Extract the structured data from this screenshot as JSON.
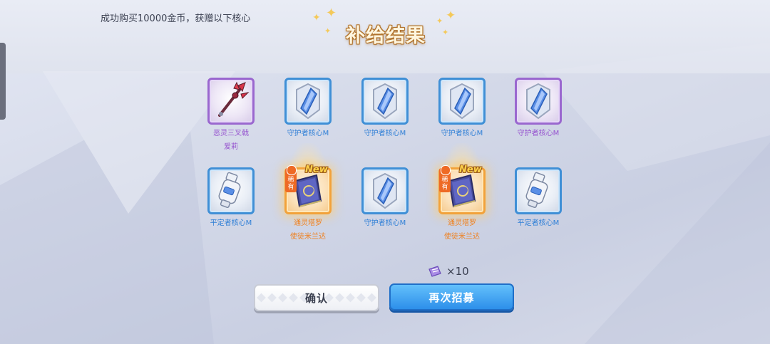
{
  "notice": "成功购买10000金币，获赠以下核心",
  "title": "补给结果",
  "items": [
    {
      "name": "恶灵三叉戟",
      "sub": "爱莉",
      "rarity": "purple",
      "icon": "trident-weapon-icon"
    },
    {
      "name": "守护者核心M",
      "sub": "",
      "rarity": "blue",
      "icon": "guardian-core-icon"
    },
    {
      "name": "守护者核心M",
      "sub": "",
      "rarity": "blue",
      "icon": "guardian-core-icon"
    },
    {
      "name": "守护者核心M",
      "sub": "",
      "rarity": "blue",
      "icon": "guardian-core-icon"
    },
    {
      "name": "守护者核心M",
      "sub": "",
      "rarity": "purple",
      "icon": "guardian-core-icon"
    },
    {
      "name": "平定者核心M",
      "sub": "",
      "rarity": "blue",
      "icon": "pacifier-core-icon"
    },
    {
      "name": "通灵塔罗",
      "sub": "使徒米兰达",
      "rarity": "orange",
      "icon": "tarot-book-icon",
      "badge": "稀有",
      "new": "New"
    },
    {
      "name": "守护者核心M",
      "sub": "",
      "rarity": "blue",
      "icon": "guardian-core-icon"
    },
    {
      "name": "通灵塔罗",
      "sub": "使徒米兰达",
      "rarity": "orange",
      "icon": "tarot-book-icon",
      "badge": "稀有",
      "new": "New"
    },
    {
      "name": "平定者核心M",
      "sub": "",
      "rarity": "blue",
      "icon": "pacifier-core-icon"
    }
  ],
  "cost": {
    "icon": "recruit-ticket-icon",
    "amount": "×10"
  },
  "buttons": {
    "confirm": "确认",
    "recruit": "再次招募"
  },
  "colors": {
    "blue_frame": "#3f8fd6",
    "purple_frame": "#9a67cf",
    "orange_frame": "#f2a23a",
    "recruit_button": "#2d8fea"
  }
}
